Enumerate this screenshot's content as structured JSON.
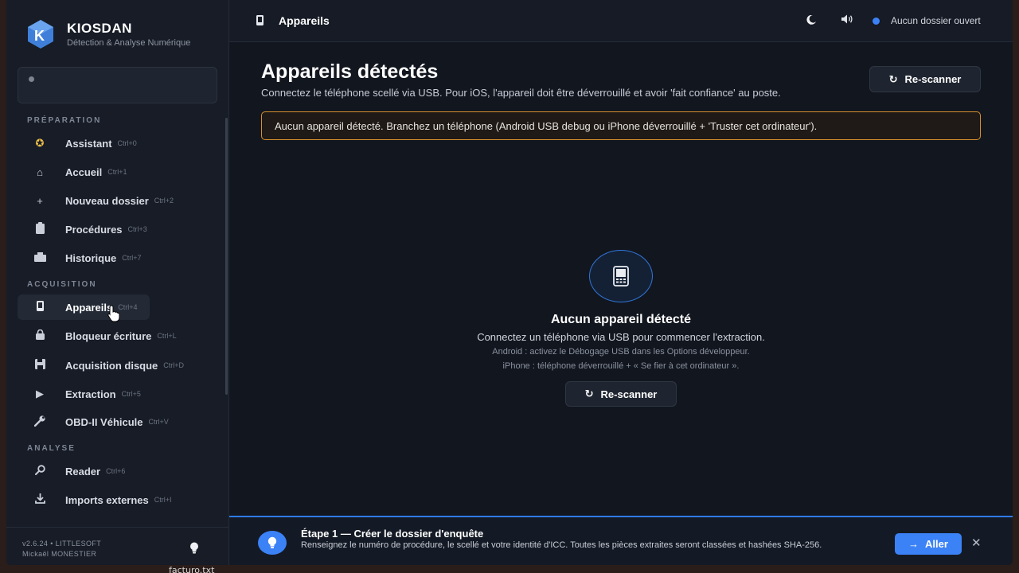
{
  "brand": {
    "name": "KIOSDAN",
    "subtitle": "Détection & Analyse Numérique",
    "logo_letter": "K"
  },
  "sidebar": {
    "sections": [
      {
        "label": "PRÉPARATION"
      },
      {
        "label": "ACQUISITION"
      },
      {
        "label": "ANALYSE"
      }
    ],
    "items": [
      {
        "label": "Assistant",
        "shortcut": "Ctrl+0",
        "icon": "compass-icon"
      },
      {
        "label": "Accueil",
        "shortcut": "Ctrl+1",
        "icon": "home-icon"
      },
      {
        "label": "Nouveau dossier",
        "shortcut": "Ctrl+2",
        "icon": "plus-icon"
      },
      {
        "label": "Procédures",
        "shortcut": "Ctrl+3",
        "icon": "clipboard-icon"
      },
      {
        "label": "Historique",
        "shortcut": "Ctrl+7",
        "icon": "archive-icon"
      },
      {
        "label": "Appareils",
        "shortcut": "Ctrl+4",
        "icon": "phone-icon",
        "active": true
      },
      {
        "label": "Bloqueur écriture",
        "shortcut": "Ctrl+L",
        "icon": "lock-icon"
      },
      {
        "label": "Acquisition disque",
        "shortcut": "Ctrl+D",
        "icon": "disk-icon"
      },
      {
        "label": "Extraction",
        "shortcut": "Ctrl+5",
        "icon": "play-icon"
      },
      {
        "label": "OBD-II Véhicule",
        "shortcut": "Ctrl+V",
        "icon": "wrench-icon"
      },
      {
        "label": "Reader",
        "shortcut": "Ctrl+6",
        "icon": "search-icon"
      },
      {
        "label": "Imports externes",
        "shortcut": "Ctrl+I",
        "icon": "download-icon"
      }
    ],
    "footer": {
      "version": "v2.6.24  •  LITTLESOFT",
      "user": "Mickaël MONESTIER"
    }
  },
  "topbar": {
    "title": "Appareils",
    "status": "Aucun dossier ouvert",
    "status_color": "#3b82f6"
  },
  "main": {
    "title": "Appareils détectés",
    "subtitle": "Connectez le téléphone scellé via USB. Pour iOS, l'appareil doit être déverrouillé et avoir 'fait confiance' au poste.",
    "rescan_label": "Re-scanner",
    "alert": "Aucun appareil détecté. Branchez un téléphone (Android USB debug ou iPhone déverrouillé + 'Truster cet ordinateur').",
    "alert_color": "#d9902c",
    "empty": {
      "title": "Aucun appareil détecté",
      "subtitle": "Connectez un téléphone via USB pour commencer l'extraction.",
      "hint_android": "Android : activez le Débogage USB dans les Options développeur.",
      "hint_iphone": "iPhone : téléphone déverrouillé + « Se fier à cet ordinateur ».",
      "rescan_label": "Re-scanner"
    }
  },
  "tip": {
    "title": "Étape 1 — Créer le dossier d'enquête",
    "text": "Renseignez le numéro de procédure, le scellé et votre identité d'ICC. Toutes les pièces extraites seront classées et hashées SHA-256.",
    "go_label": "Aller"
  },
  "desktop": {
    "file_label": "facturo.txt"
  }
}
